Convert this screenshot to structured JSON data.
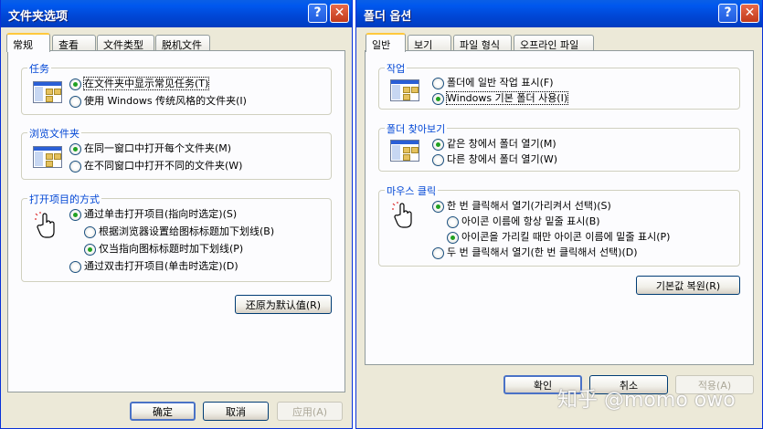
{
  "zh": {
    "title": "文件夹选项",
    "tabs": [
      "常规",
      "查看",
      "文件类型",
      "脱机文件"
    ],
    "groups": {
      "tasks": {
        "legend": "任务",
        "options": [
          "在文件夹中显示常见任务(T)",
          "使用 Windows 传统风格的文件夹(I)"
        ]
      },
      "browse": {
        "legend": "浏览文件夹",
        "options": [
          "在同一窗口中打开每个文件夹(M)",
          "在不同窗口中打开不同的文件夹(W)"
        ]
      },
      "click": {
        "legend": "打开项目的方式",
        "options": [
          "通过单击打开项目(指向时选定)(S)",
          "根据浏览器设置给图标标题加下划线(B)",
          "仅当指向图标标题时加下划线(P)",
          "通过双击打开项目(单击时选定)(D)"
        ]
      }
    },
    "restore_label": "还原为默认值(R)",
    "ok_label": "确定",
    "cancel_label": "取消",
    "apply_label": "应用(A)"
  },
  "ko": {
    "title": "폴더 옵션",
    "tabs": [
      "일반",
      "보기",
      "파일 형식",
      "오프라인 파일"
    ],
    "groups": {
      "tasks": {
        "legend": "작업",
        "options": [
          "폴더에 일반 작업 표시(F)",
          "Windows 기본 폴더 사용(I)"
        ]
      },
      "browse": {
        "legend": "폴더 찾아보기",
        "options": [
          "같은 창에서 폴더 열기(M)",
          "다른 창에서 폴더 열기(W)"
        ]
      },
      "click": {
        "legend": "마우스 클릭",
        "options": [
          "한 번 클릭해서 열기(가리켜서 선택)(S)",
          "아이콘 이름에 항상 밑줄 표시(B)",
          "아이콘을 가리킬 때만 아이콘 이름에 밑줄 표시(P)",
          "두 번 클릭해서 열기(한 번 클릭해서 선택)(D)"
        ]
      }
    },
    "restore_label": "기본값 복원(R)",
    "ok_label": "확인",
    "cancel_label": "취소",
    "apply_label": "적용(A)"
  },
  "watermark": "知乎 @momo owo",
  "icons": {
    "help": "?",
    "close": "✕"
  },
  "colors": {
    "titlebar": "#0058ee",
    "legend": "#0046d5",
    "selected_radio": "#21a121",
    "tab_accent": "#ffc83c"
  }
}
